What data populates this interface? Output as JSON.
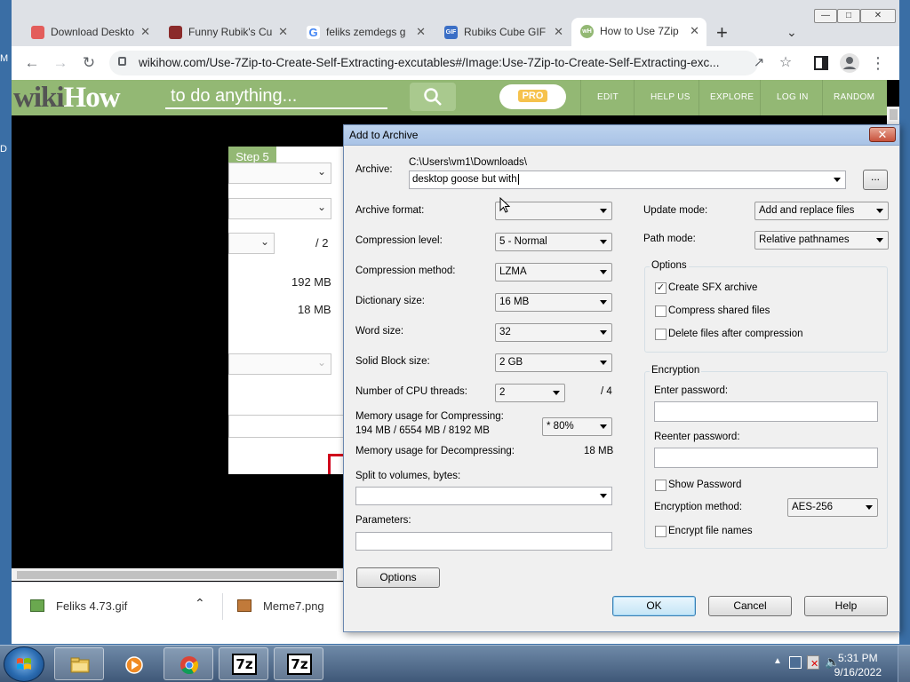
{
  "chrome": {
    "tabs": [
      {
        "title": "Download Deskto",
        "icon": "download-site-icon"
      },
      {
        "title": "Funny Rubik's Cu",
        "icon": "rubiks-site-icon"
      },
      {
        "title": "feliks zemdegs g",
        "icon": "google-icon"
      },
      {
        "title": "Rubiks Cube GIF",
        "icon": "gif-site-icon",
        "favicon_text": "GIF"
      },
      {
        "title": "How to Use 7Zip",
        "icon": "wikihow-icon",
        "favicon_text": "wH"
      }
    ],
    "url": "wikihow.com/Use-7Zip-to-Create-Self-Extracting-excutables#/Image:Use-7Zip-to-Create-Self-Extracting-exc...",
    "new_tab": "+"
  },
  "wikihow": {
    "logo_a": "wiki",
    "logo_b": "How",
    "search_placeholder": "to do anything...",
    "pro": "PRO",
    "nav": [
      "EDIT",
      "HELP US",
      "EXPLORE",
      "LOG IN",
      "RANDOM"
    ],
    "step": "Step 5",
    "img_values": {
      "v1": "/ 2",
      "v2": "192 MB",
      "v3": "18 MB"
    }
  },
  "downloads": [
    {
      "name": "Feliks 4.73.gif"
    },
    {
      "name": "Meme7.png"
    }
  ],
  "dialog": {
    "title": "Add to Archive",
    "archive_label": "Archive:",
    "archive_path": "C:\\Users\\vm1\\Downloads\\",
    "archive_name": "desktop goose but with",
    "browse": "...",
    "format_label": "Archive format:",
    "format_value": "",
    "level_label": "Compression level:",
    "level_value": "5 - Normal",
    "method_label": "Compression method:",
    "method_value": "LZMA",
    "dict_label": "Dictionary size:",
    "dict_value": "16 MB",
    "word_label": "Word size:",
    "word_value": "32",
    "solid_label": "Solid Block size:",
    "solid_value": "2 GB",
    "threads_label": "Number of CPU threads:",
    "threads_value": "2",
    "threads_max": "/ 4",
    "mem_comp_label": "Memory usage for Compressing:",
    "mem_comp_value": "194 MB / 6554 MB / 8192 MB",
    "mem_pct": "* 80%",
    "mem_decomp_label": "Memory usage for Decompressing:",
    "mem_decomp_value": "18 MB",
    "split_label": "Split to volumes, bytes:",
    "split_value": "",
    "params_label": "Parameters:",
    "params_value": "",
    "update_label": "Update mode:",
    "update_value": "Add and replace files",
    "path_label": "Path mode:",
    "path_value": "Relative pathnames",
    "options_group": "Options",
    "opt_sfx": "Create SFX archive",
    "opt_sfx_checked": true,
    "opt_shared": "Compress shared files",
    "opt_shared_checked": false,
    "opt_delete": "Delete files after compression",
    "opt_delete_checked": false,
    "enc_group": "Encryption",
    "enter_pw": "Enter password:",
    "reenter_pw": "Reenter password:",
    "show_pw": "Show Password",
    "show_pw_checked": false,
    "enc_method_label": "Encryption method:",
    "enc_method_value": "AES-256",
    "enc_names": "Encrypt file names",
    "enc_names_checked": false,
    "options_btn": "Options",
    "ok": "OK",
    "cancel": "Cancel",
    "help": "Help"
  },
  "taskbar": {
    "time": "5:31 PM",
    "date": "9/16/2022",
    "apps": [
      "explorer-icon",
      "media-player-icon",
      "chrome-icon",
      "7zip-icon",
      "7zip-icon"
    ],
    "sevenzip_label": "7z"
  },
  "colors": {
    "wikihow_green": "#93b874",
    "taskbar_blue": "#3f5878",
    "dialog_bg": "#f0f0f0"
  }
}
